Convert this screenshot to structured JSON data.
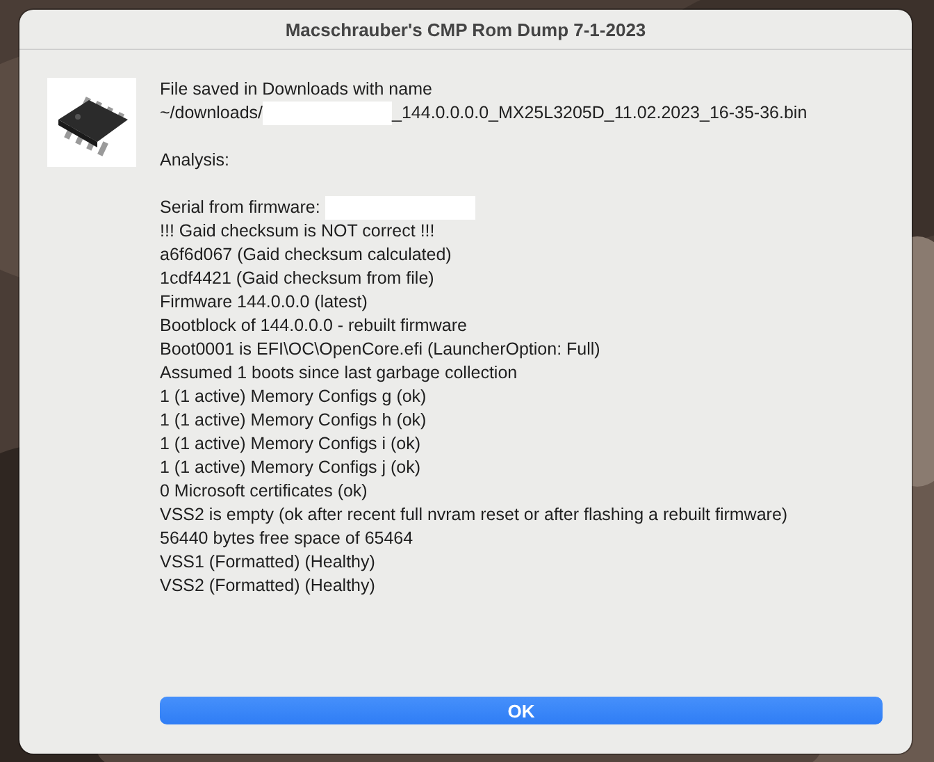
{
  "window": {
    "title": "Macschrauber's CMP Rom Dump 7-1-2023"
  },
  "blocks": [
    {
      "lines": [
        [
          {
            "kind": "text",
            "text": "File saved in Downloads with name"
          }
        ],
        [
          {
            "kind": "text",
            "text": "~/downloads/"
          },
          {
            "kind": "redacted"
          },
          {
            "kind": "text",
            "text": "_144.0.0.0.0_MX25L3205D_11.02.2023_16-35-36.bin"
          }
        ]
      ]
    },
    {
      "lines": [
        [
          {
            "kind": "text",
            "text": "Analysis:"
          }
        ]
      ]
    },
    {
      "lines": [
        [
          {
            "kind": "text",
            "text": "Serial from firmware:"
          },
          {
            "kind": "redacted"
          }
        ],
        [
          {
            "kind": "text",
            "text": "!!! Gaid checksum is NOT correct !!!"
          }
        ],
        [
          {
            "kind": "text",
            "text": "a6f6d067 (Gaid checksum calculated)"
          }
        ],
        [
          {
            "kind": "text",
            "text": "1cdf4421 (Gaid checksum from file)"
          }
        ],
        [
          {
            "kind": "text",
            "text": "Firmware 144.0.0.0 (latest)"
          }
        ],
        [
          {
            "kind": "text",
            "text": "Bootblock of 144.0.0.0 - rebuilt firmware"
          }
        ],
        [
          {
            "kind": "text",
            "text": "Boot0001 is EFI\\OC\\OpenCore.efi (LauncherOption: Full)"
          }
        ],
        [
          {
            "kind": "text",
            "text": "Assumed 1 boots since last garbage collection"
          }
        ],
        [
          {
            "kind": "text",
            "text": "1 (1 active) Memory Configs g (ok)"
          }
        ],
        [
          {
            "kind": "text",
            "text": "1 (1 active) Memory Configs h (ok)"
          }
        ],
        [
          {
            "kind": "text",
            "text": "1 (1 active) Memory Configs i (ok)"
          }
        ],
        [
          {
            "kind": "text",
            "text": "1 (1 active) Memory Configs j (ok)"
          }
        ],
        [
          {
            "kind": "text",
            "text": "0 Microsoft certificates (ok)"
          }
        ],
        [
          {
            "kind": "text",
            "text": "VSS2 is empty (ok after recent full nvram reset or after flashing a rebuilt firmware)"
          }
        ],
        [
          {
            "kind": "text",
            "text": "56440 bytes free space of 65464"
          }
        ],
        [
          {
            "kind": "text",
            "text": "VSS1 (Formatted) (Healthy)"
          }
        ],
        [
          {
            "kind": "text",
            "text": "VSS2 (Formatted) (Healthy)"
          }
        ]
      ]
    }
  ],
  "buttons": [
    {
      "label": "OK"
    }
  ]
}
